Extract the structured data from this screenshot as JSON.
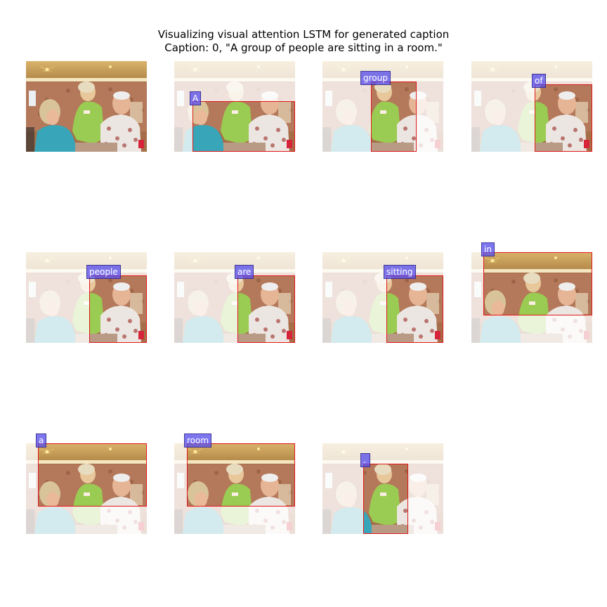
{
  "figure": {
    "title_line1": "Visualizing visual attention LSTM for generated caption",
    "title_line2": "Caption: 0, \"A group of people are sitting in a room.\""
  },
  "panels": [
    {
      "kind": "original",
      "word": ""
    },
    {
      "kind": "attention",
      "word": "A"
    },
    {
      "kind": "attention",
      "word": "group"
    },
    {
      "kind": "attention",
      "word": "of"
    },
    {
      "kind": "attention",
      "word": "people"
    },
    {
      "kind": "attention",
      "word": "are"
    },
    {
      "kind": "attention",
      "word": "sitting"
    },
    {
      "kind": "attention",
      "word": "in"
    },
    {
      "kind": "attention",
      "word": "a"
    },
    {
      "kind": "attention",
      "word": "room"
    },
    {
      "kind": "attention",
      "word": "."
    }
  ],
  "colors": {
    "attention_box": "#e01818",
    "word_tag": "#5a50eb"
  }
}
